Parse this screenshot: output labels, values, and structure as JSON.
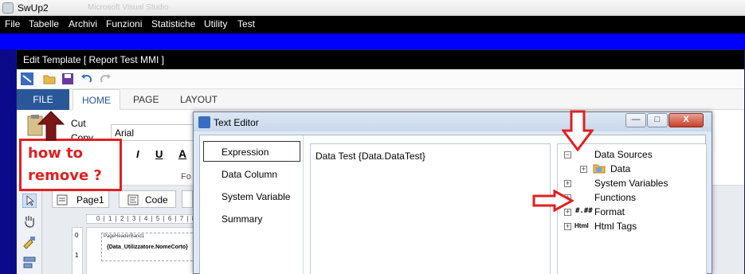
{
  "app": {
    "title": "SwUp2",
    "faded_title": "Microsoft Visual Studio",
    "menu": [
      "File",
      "Tabelle",
      "Archivi",
      "Funzioni",
      "Statistiche",
      "Utility",
      "Test"
    ]
  },
  "template_window": {
    "title": "Edit Template [ Report Test MMI ]",
    "tabs": {
      "file": "FILE",
      "home": "HOME",
      "page": "PAGE",
      "layout": "LAYOUT"
    },
    "clipboard": {
      "cut": "Cut",
      "copy": "Copy"
    },
    "font_name": "Arial",
    "font_group_partial": "Fo",
    "format_buttons": [
      "I",
      "U",
      "A"
    ],
    "view_tabs": {
      "page1": "Page1",
      "code": "Code"
    },
    "ruler_text": "0 | 1 | 2 | 3 | 4 | 5 | 6 | 7 | 8",
    "page_band": "PageHeaderBand1",
    "field_text": "{Data_Utilizzatore.NomeCorto}",
    "ruler_v": [
      "0",
      "1"
    ]
  },
  "text_editor": {
    "title": "Text Editor",
    "window_buttons": {
      "minimize": "—",
      "maximize": "□",
      "close": "X"
    },
    "left_items": [
      "Expression",
      "Data Column",
      "System Variable",
      "Summary"
    ],
    "expression": "Data Test {Data.DataTest}",
    "tree": [
      {
        "label": "Data Sources",
        "expander": "−"
      },
      {
        "label": "Data",
        "expander": "+"
      },
      {
        "label": "System Variables",
        "expander": "+"
      },
      {
        "label": "Functions",
        "expander": "+"
      },
      {
        "label": "Format",
        "expander": "+",
        "icon": "#.##"
      },
      {
        "label": "Html Tags",
        "expander": "+",
        "icon": "Html"
      }
    ]
  },
  "annotation": {
    "line1": "how to",
    "line2": "remove ?",
    "color": "#e02020"
  },
  "colors": {
    "ribbon_file": "#2a579a",
    "menubar": "#000000",
    "blue_band": "#0000ff",
    "dialog_bg": "#dfe9f5"
  }
}
